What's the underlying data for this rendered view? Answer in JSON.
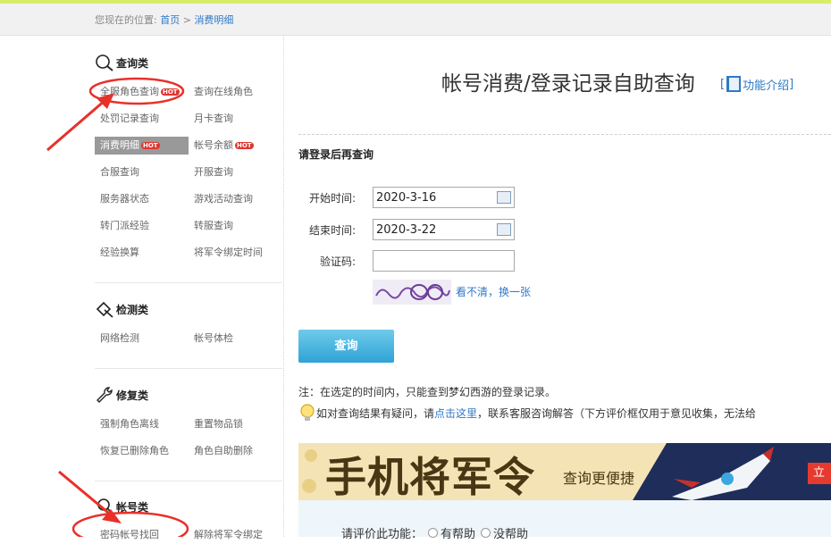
{
  "breadcrumb": {
    "prefix": "您现在的位置:",
    "home": "首页",
    "sep": ">",
    "current": "消费明细"
  },
  "sidebar": {
    "sections": [
      {
        "title": "查询类",
        "icon": "magnifier-icon"
      },
      {
        "title": "检测类",
        "icon": "diamond-check-icon"
      },
      {
        "title": "修复类",
        "icon": "wrench-icon"
      },
      {
        "title": "帐号类",
        "icon": "account-icon"
      }
    ],
    "hot_badge": "HOT",
    "query_items": [
      {
        "label": "全服角色查询",
        "hot": true
      },
      {
        "label": "查询在线角色"
      },
      {
        "label": "处罚记录查询"
      },
      {
        "label": "月卡查询"
      },
      {
        "label": "消费明细",
        "hot": true,
        "active": true
      },
      {
        "label": "帐号余额",
        "hot": true
      },
      {
        "label": "合服查询"
      },
      {
        "label": "开服查询"
      },
      {
        "label": "服务器状态"
      },
      {
        "label": "游戏活动查询"
      },
      {
        "label": "转门派经验"
      },
      {
        "label": "转服查询"
      },
      {
        "label": "经验换算"
      },
      {
        "label": "将军令绑定时间"
      }
    ],
    "detect_items": [
      "网络检测",
      "帐号体检"
    ],
    "repair_items": [
      "强制角色离线",
      "重置物品锁",
      "恢复已删除角色",
      "角色自助删除"
    ],
    "account_items": [
      "密码帐号找回",
      "解除将军令绑定"
    ]
  },
  "main": {
    "title": "帐号消费/登录记录自助查询",
    "intro_label": "功能介绍",
    "intro_open": "[",
    "intro_close": "]",
    "login_hint": "请登录后再查询",
    "start_label": "开始时间:",
    "start_value": "2020-3-16",
    "end_label": "结束时间:",
    "end_value": "2020-3-22",
    "captcha_label": "验证码:",
    "captcha_value": "",
    "refresh_label": "看不清，换一张",
    "query_button": "查询",
    "note1": "注：在选定的时间内，只能查到梦幻西游的登录记录。",
    "note2_prefix": "如对查询结果有疑问，请",
    "note2_link": "点击这里",
    "note2_suffix": "，联系客服咨询解答（下方评价框仅用于意见收集，无法给",
    "banner_big": "手机将军令",
    "banner_small": "查询更便捷",
    "banner_button": "立",
    "rate_label": "请评价此功能：",
    "rate_opt1": "有帮助",
    "rate_opt2": "没帮助"
  },
  "colors": {
    "link": "#2f79c6",
    "hot": "#e0352f",
    "annotation": "#e8302a",
    "button": "#2fa2d6"
  }
}
